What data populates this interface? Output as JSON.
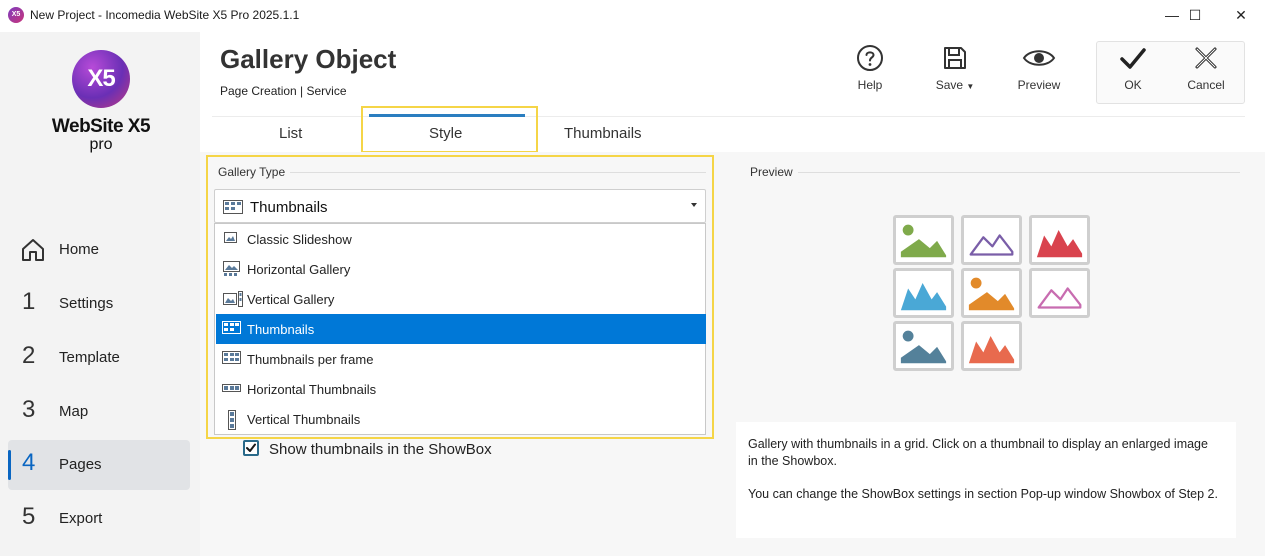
{
  "window": {
    "title": "New Project - Incomedia WebSite X5 Pro 2025.1.1",
    "app_icon_text": "X5",
    "controls": {
      "minimize": "—",
      "maximize": "☐",
      "close": "✕"
    }
  },
  "logo": {
    "mark": "X5",
    "name": "WebSite X5",
    "edition": "pro"
  },
  "sidebar": {
    "items": [
      {
        "num": "",
        "label": "Home",
        "icon": "home-icon"
      },
      {
        "num": "1",
        "label": "Settings"
      },
      {
        "num": "2",
        "label": "Template"
      },
      {
        "num": "3",
        "label": "Map"
      },
      {
        "num": "4",
        "label": "Pages",
        "active": true
      },
      {
        "num": "5",
        "label": "Export"
      }
    ]
  },
  "header": {
    "title": "Gallery Object",
    "breadcrumb": "Page Creation | Service"
  },
  "toolbar": {
    "help": "Help",
    "save": "Save",
    "preview": "Preview",
    "ok": "OK",
    "cancel": "Cancel"
  },
  "tabs": {
    "list": "List",
    "style": "Style",
    "thumbnails": "Thumbnails",
    "active": "Style"
  },
  "gallery_type": {
    "group_label": "Gallery Type",
    "selected": "Thumbnails",
    "options": [
      {
        "label": "Classic Slideshow",
        "icon": "slideshow-icon"
      },
      {
        "label": "Horizontal Gallery",
        "icon": "horizontal-gallery-icon"
      },
      {
        "label": "Vertical Gallery",
        "icon": "vertical-gallery-icon"
      },
      {
        "label": "Thumbnails",
        "icon": "thumbnails-grid-icon",
        "selected": true
      },
      {
        "label": "Thumbnails per frame",
        "icon": "thumbnails-frame-icon"
      },
      {
        "label": "Horizontal Thumbnails",
        "icon": "horizontal-thumbnails-icon"
      },
      {
        "label": "Vertical Thumbnails",
        "icon": "vertical-thumbnails-icon"
      }
    ]
  },
  "show_in_showbox": {
    "label": "Show thumbnails in the ShowBox",
    "checked": true
  },
  "preview": {
    "label": "Preview",
    "thumb_colors": [
      "#7faa4b",
      "#7a5ea8",
      "#d9434e",
      "#4aa8d6",
      "#e28a2a",
      "#c86cb0",
      "#54819a",
      "#e86a4e"
    ],
    "description_1": "Gallery with thumbnails in a grid. Click on a thumbnail to display an enlarged image in the Showbox.",
    "description_2": "You can change the ShowBox settings in section Pop-up window Showbox of Step 2."
  },
  "colors": {
    "accent": "#0078d7",
    "highlight": "#f5d547",
    "tab_underline": "#2a7ec0"
  }
}
